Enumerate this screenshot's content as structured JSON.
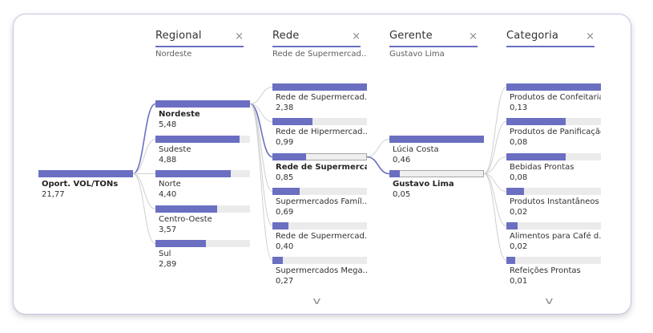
{
  "colors": {
    "accent": "#6b6fc1",
    "track": "#ebebeb",
    "link": "#6b6fc1"
  },
  "root": {
    "label": "Oport. VOL/TONs",
    "value": "21,77",
    "fraction": 1.0
  },
  "levels": [
    {
      "title": "Regional",
      "filter": "Nordeste",
      "close_icon": "×",
      "nodes": [
        {
          "label": "Nordeste",
          "value": "5,48",
          "fraction": 1.0,
          "selected": true
        },
        {
          "label": "Sudeste",
          "value": "4,88",
          "fraction": 0.89
        },
        {
          "label": "Norte",
          "value": "4,40",
          "fraction": 0.8
        },
        {
          "label": "Centro-Oeste",
          "value": "3,57",
          "fraction": 0.65
        },
        {
          "label": "Sul",
          "value": "2,89",
          "fraction": 0.53
        }
      ]
    },
    {
      "title": "Rede",
      "filter": "Rede de Supermercad...",
      "close_icon": "×",
      "nodes": [
        {
          "label": "Rede de Supermercad...",
          "value": "2,38",
          "fraction": 1.0
        },
        {
          "label": "Rede de Hipermercad...",
          "value": "0,99",
          "fraction": 0.42
        },
        {
          "label": "Rede de Supermerca...",
          "value": "0,85",
          "fraction": 0.36,
          "selected": true
        },
        {
          "label": "Supermercados Famíl...",
          "value": "0,69",
          "fraction": 0.29
        },
        {
          "label": "Rede de Supermercad...",
          "value": "0,40",
          "fraction": 0.17
        },
        {
          "label": "Supermercados Mega...",
          "value": "0,27",
          "fraction": 0.11
        }
      ]
    },
    {
      "title": "Gerente",
      "filter": "Gustavo Lima",
      "close_icon": "×",
      "nodes": [
        {
          "label": "Lúcia Costa",
          "value": "0,46",
          "fraction": 1.0
        },
        {
          "label": "Gustavo Lima",
          "value": "0,05",
          "fraction": 0.11,
          "selected": true
        }
      ]
    },
    {
      "title": "Categoria",
      "filter": "",
      "close_icon": "×",
      "nodes": [
        {
          "label": "Produtos de Confeitaria",
          "value": "0,13",
          "fraction": 1.0
        },
        {
          "label": "Produtos de Panificação",
          "value": "0,08",
          "fraction": 0.63
        },
        {
          "label": "Bebidas Prontas",
          "value": "0,08",
          "fraction": 0.63
        },
        {
          "label": "Produtos Instantâneos",
          "value": "0,02",
          "fraction": 0.19
        },
        {
          "label": "Alimentos para Café d...",
          "value": "0,02",
          "fraction": 0.12
        },
        {
          "label": "Refeições Prontas",
          "value": "0,01",
          "fraction": 0.09
        }
      ]
    }
  ],
  "scroll_icon": "∨"
}
